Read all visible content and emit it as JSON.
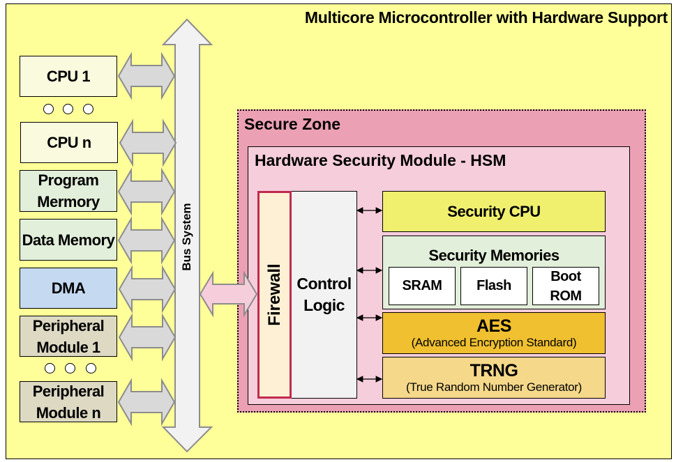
{
  "title": "Multicore Microcontroller with Hardware Support",
  "bus": {
    "label": "Bus System"
  },
  "left_blocks": [
    {
      "label": "CPU 1",
      "color": "#fafade"
    },
    {
      "label": "CPU n",
      "color": "#fafade"
    },
    {
      "label": "Program Mermory",
      "color": "#e2efda"
    },
    {
      "label": "Data Memory",
      "color": "#e2efda"
    },
    {
      "label": "DMA",
      "color": "#c5d9f1"
    },
    {
      "label": "Peripheral Module 1",
      "color": "#ddd9c3"
    },
    {
      "label": "Peripheral Module n",
      "color": "#ddd9c3"
    }
  ],
  "secure_zone": {
    "label": "Secure Zone",
    "hsm": {
      "label": "Hardware Security Module - HSM",
      "firewall": "Firewall",
      "control_logic": "Control Logic",
      "security_cpu": "Security CPU",
      "security_memories": {
        "label": "Security Memories",
        "items": [
          "SRAM",
          "Flash",
          "Boot ROM"
        ]
      },
      "aes": {
        "label": "AES",
        "sub": "(Advanced Encryption Standard)"
      },
      "trng": {
        "label": "TRNG",
        "sub": "(True Random Number Generator)"
      }
    }
  }
}
